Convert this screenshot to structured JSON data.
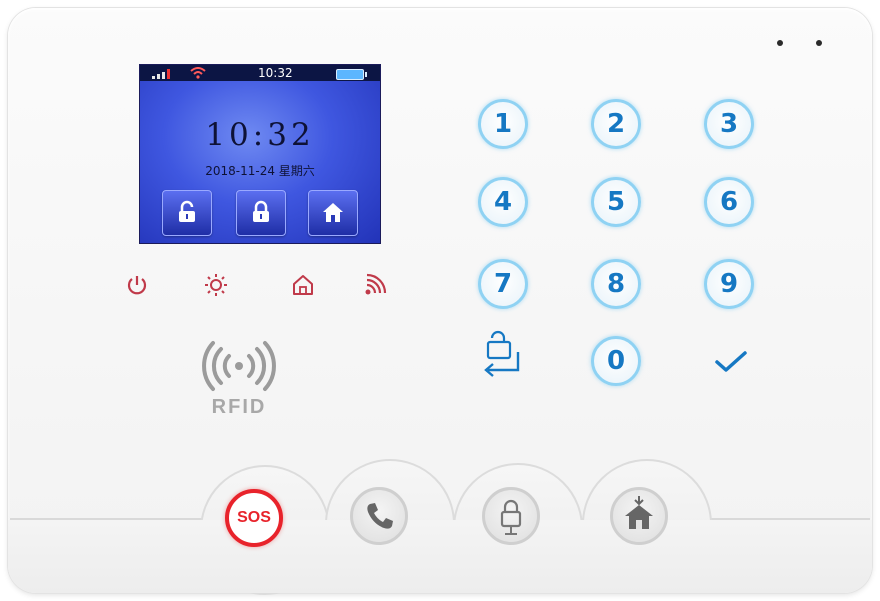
{
  "screen": {
    "status_time": "10:32",
    "clock": "10:32",
    "date": "2018-11-24  星期六",
    "buttons": [
      {
        "name": "disarm",
        "icon": "unlocked-padlock-icon"
      },
      {
        "name": "arm",
        "icon": "locked-padlock-icon"
      },
      {
        "name": "home-arm",
        "icon": "home-icon"
      }
    ]
  },
  "indicators": [
    {
      "name": "power",
      "icon": "power-icon"
    },
    {
      "name": "brightness",
      "icon": "sun-icon"
    },
    {
      "name": "home",
      "icon": "house-icon"
    },
    {
      "name": "signal",
      "icon": "signal-icon"
    }
  ],
  "rfid": {
    "label": "RFID",
    "icon": "rfid-wave-icon"
  },
  "keypad": {
    "keys": [
      "1",
      "2",
      "3",
      "4",
      "5",
      "6",
      "7",
      "8",
      "9",
      "0"
    ],
    "switch_icon": "lock-switch-icon",
    "confirm_icon": "checkmark-icon"
  },
  "bottom": {
    "sos_label": "SOS",
    "call_icon": "phone-icon",
    "arm_icon": "padlock-arm-icon",
    "home_arm_icon": "home-arm-icon"
  },
  "colors": {
    "accent_blue": "#1678c3",
    "key_ring": "#8fd2f3",
    "indicator_red": "#c03a4a",
    "sos_red": "#e8232b",
    "screen_blue": "#3f57e0"
  }
}
